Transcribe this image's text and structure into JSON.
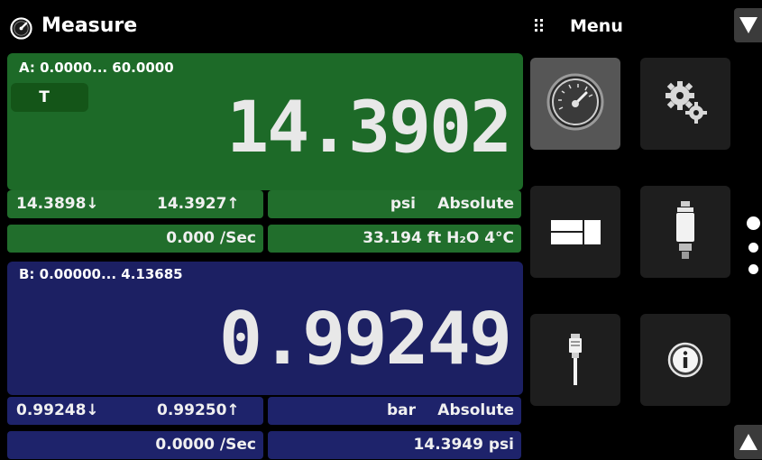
{
  "header": {
    "title": "Measure",
    "icon": "gauge-icon"
  },
  "menu": {
    "label": "Menu",
    "icon": "grid-dots-icon",
    "items": [
      {
        "name": "measure",
        "icon": "gauge-icon",
        "active": true
      },
      {
        "name": "settings",
        "icon": "gears-icon",
        "active": false
      },
      {
        "name": "display",
        "icon": "display-layout-icon",
        "active": false
      },
      {
        "name": "sensor",
        "icon": "transducer-icon",
        "active": false
      },
      {
        "name": "remote",
        "icon": "cable-connector-icon",
        "active": false
      },
      {
        "name": "info",
        "icon": "info-icon",
        "active": false
      }
    ],
    "page_dots": 3
  },
  "channel_a": {
    "range": "A: 0.0000... 60.0000",
    "tare_label": "T",
    "reading": "14.3902",
    "min": "14.3898↓",
    "max": "14.3927↑",
    "unit": "psi",
    "mode": "Absolute",
    "rate": "0.000 /Sec",
    "alt_reading": "33.194 ft H₂O 4°C",
    "color": "#1d6a28"
  },
  "channel_b": {
    "range": "B: 0.00000... 4.13685",
    "reading": "0.99249",
    "min": "0.99248↓",
    "max": "0.99250↑",
    "unit": "bar",
    "mode": "Absolute",
    "rate": "0.0000 /Sec",
    "alt_reading": "14.3949 psi",
    "color": "#1c2063"
  }
}
